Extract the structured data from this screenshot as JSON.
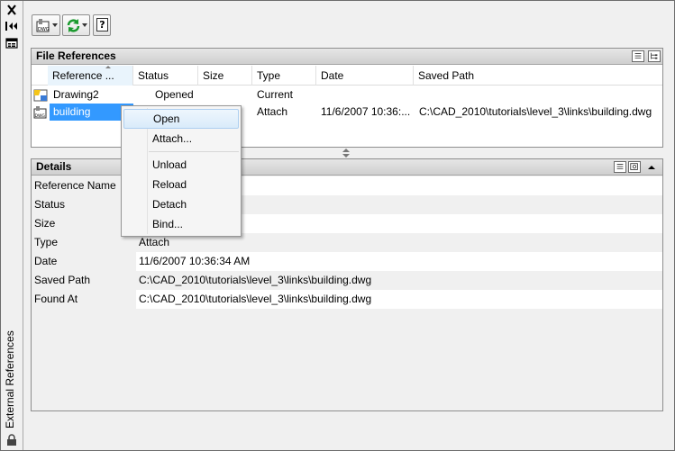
{
  "palette": {
    "selection": "#3399ff",
    "menu_highlight": "#d9ebfa",
    "panel_header": "#d6d6d6"
  },
  "titlebar": {
    "title": "External References",
    "icons": [
      "close-icon",
      "auto-hide-icon",
      "properties-icon",
      "lock-icon"
    ]
  },
  "toolbar": {
    "icons": [
      "attach-dwg-icon",
      "refresh-icon",
      "help-icon"
    ],
    "help_label": "?"
  },
  "file_references": {
    "title": "File References",
    "columns": [
      "Reference ...",
      "Status",
      "Size",
      "Type",
      "Date",
      "Saved Path"
    ],
    "rows": [
      {
        "name": "Drawing2",
        "status": "Opened",
        "size": "",
        "type": "Current",
        "date": "",
        "path": ""
      },
      {
        "name": "building",
        "status": "",
        "size": "",
        "type": "Attach",
        "date": "11/6/2007 10:36:...",
        "path": "C:\\CAD_2010\\tutorials\\level_3\\links\\building.dwg"
      }
    ]
  },
  "details": {
    "title": "Details",
    "rows": [
      {
        "label": "Reference Name",
        "value": ""
      },
      {
        "label": "Status",
        "value": ""
      },
      {
        "label": "Size",
        "value": ""
      },
      {
        "label": "Type",
        "value": "Attach"
      },
      {
        "label": "Date",
        "value": "11/6/2007 10:36:34 AM"
      },
      {
        "label": "Saved Path",
        "value": "C:\\CAD_2010\\tutorials\\level_3\\links\\building.dwg"
      },
      {
        "label": "Found At",
        "value": "C:\\CAD_2010\\tutorials\\level_3\\links\\building.dwg"
      }
    ]
  },
  "context_menu": {
    "items": [
      "Open",
      "Attach...",
      "Unload",
      "Reload",
      "Detach",
      "Bind..."
    ],
    "highlighted": "Open"
  }
}
